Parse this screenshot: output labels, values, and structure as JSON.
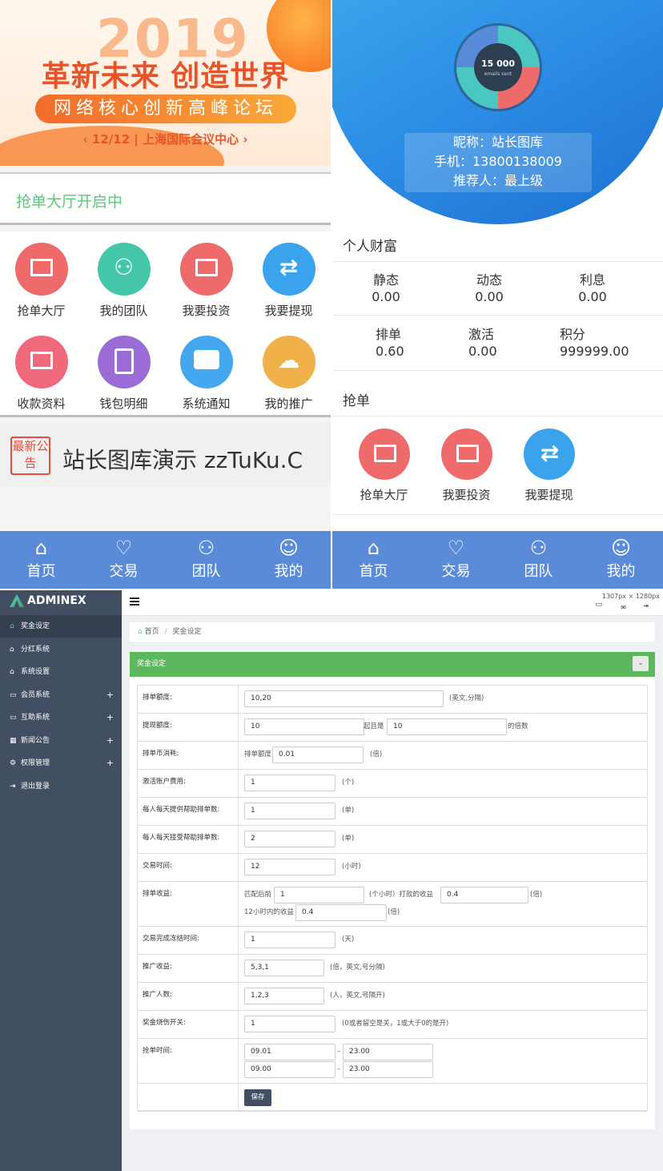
{
  "left_phone": {
    "banner": {
      "year": "2019",
      "headline": "革新未来 创造世界",
      "forum": "网络核心创新高峰论坛",
      "date_venue": "‹ 12/12 | 上海国际会议中心 ›"
    },
    "hall_status": "抢单大厅开启中",
    "grid_items": [
      {
        "label": "抢单大厅",
        "icon": "browser-hand-icon",
        "color": "#ef6b6b"
      },
      {
        "label": "我的团队",
        "icon": "team-icon",
        "color": "#45c6a8"
      },
      {
        "label": "我要投资",
        "icon": "browser-hand-icon",
        "color": "#ef6b6b"
      },
      {
        "label": "我要提现",
        "icon": "swap-arrows-icon",
        "color": "#3aa3ee"
      },
      {
        "label": "收款资料",
        "icon": "card-icon",
        "color": "#f06a7c"
      },
      {
        "label": "钱包明细",
        "icon": "clipboard-icon",
        "color": "#9b6bd8"
      },
      {
        "label": "系统通知",
        "icon": "chat-bubble-icon",
        "color": "#43a8f0"
      },
      {
        "label": "我的推广",
        "icon": "cloud-person-icon",
        "color": "#f0b04a"
      }
    ],
    "announcement": {
      "badge": "最新公告",
      "text": "站长图库演示 zzTuKu.C"
    }
  },
  "tabbar": [
    {
      "label": "首页",
      "icon": "home-icon"
    },
    {
      "label": "交易",
      "icon": "handshake-icon"
    },
    {
      "label": "团队",
      "icon": "team-icon"
    },
    {
      "label": "我的",
      "icon": "user-icon"
    }
  ],
  "right_phone": {
    "donut": {
      "center_value": "15 000",
      "center_label": "emails sent"
    },
    "profile": {
      "nickname": "昵称：站长图库",
      "phone": "手机：13800138009",
      "referrer": "推荐人：最上级"
    },
    "wealth_title": "个人财富",
    "wealth": [
      {
        "label": "静态",
        "value": "0.00"
      },
      {
        "label": "动态",
        "value": "0.00"
      },
      {
        "label": "利息",
        "value": "0.00"
      },
      {
        "label": "排单",
        "value": "0.60"
      },
      {
        "label": "激活",
        "value": "0.00"
      },
      {
        "label": "积分",
        "value": "999999.00"
      }
    ],
    "grab_title": "抢单",
    "grab_items": [
      {
        "label": "抢单大厅",
        "color": "#ef6b6b"
      },
      {
        "label": "我要投资",
        "color": "#ef6b6b"
      },
      {
        "label": "我要提现",
        "color": "#3aa3ee"
      }
    ]
  },
  "admin": {
    "brand": "ADMINEX",
    "resolution": "1307px × 1280px",
    "menu": [
      {
        "label": "奖金设定",
        "icon": "home-icon",
        "active": true,
        "expandable": false
      },
      {
        "label": "分红系统",
        "icon": "home-icon",
        "active": false,
        "expandable": false
      },
      {
        "label": "系统设置",
        "icon": "home-icon",
        "active": false,
        "expandable": false
      },
      {
        "label": "会员系统",
        "icon": "laptop-icon",
        "active": false,
        "expandable": true
      },
      {
        "label": "互助系统",
        "icon": "laptop-icon",
        "active": false,
        "expandable": true
      },
      {
        "label": "新闻公告",
        "icon": "chart-icon",
        "active": false,
        "expandable": true
      },
      {
        "label": "权限管理",
        "icon": "cogs-icon",
        "active": false,
        "expandable": true
      },
      {
        "label": "退出登录",
        "icon": "sign-out-icon",
        "active": false,
        "expandable": false
      }
    ],
    "breadcrumb": {
      "home": "首页",
      "current": "奖金设定",
      "sep": "/"
    },
    "panel_title": "奖金设定",
    "form": {
      "queue_amount": {
        "label": "排单额度:",
        "value": "10,20",
        "note": "(英文,分隔)"
      },
      "withdraw_amount": {
        "label": "提现额度:",
        "value": "10",
        "mid": "起且是",
        "value2": "10",
        "note": "的倍数"
      },
      "queue_coin": {
        "label": "排单币消耗:",
        "prefix": "排单额度",
        "value": "0.01",
        "note": "(倍)"
      },
      "activation_fee": {
        "label": "激活账户费用:",
        "value": "1",
        "note": "(个)"
      },
      "daily_provide": {
        "label": "每人每天提供帮助排单数:",
        "value": "1",
        "note": "(单)"
      },
      "daily_accept": {
        "label": "每人每天接受帮助排单数:",
        "value": "2",
        "note": "(单)"
      },
      "trade_time": {
        "label": "交易时间:",
        "value": "12",
        "note": "(小时)"
      },
      "queue_income": {
        "label": "排单收益:",
        "prefix": "匹配后前",
        "value": "1",
        "mid": "(个小时）打款的收益",
        "value2": "0.4",
        "note": "(倍)",
        "prefix2": "12小时内的收益",
        "value3": "0.4",
        "note2": "(倍)"
      },
      "freeze_time": {
        "label": "交易完成冻结时间:",
        "value": "1",
        "note": "(天)"
      },
      "promo_income": {
        "label": "推广收益:",
        "value": "5,3,1",
        "note": "(倍，英文,号分隔)"
      },
      "promo_count": {
        "label": "推广人数:",
        "value": "1,2,3",
        "note": "(人，英文,号隔开)"
      },
      "burn_switch": {
        "label": "奖金烧伤开关:",
        "value": "1",
        "note": "(0或者留空是关，1或大于0的是开)"
      },
      "grab_time": {
        "label": "抢单时间:",
        "from1": "09.01",
        "to1": "23.00",
        "from2": "09.00",
        "to2": "23.00",
        "dash": "–"
      },
      "save_label": "保存"
    }
  }
}
